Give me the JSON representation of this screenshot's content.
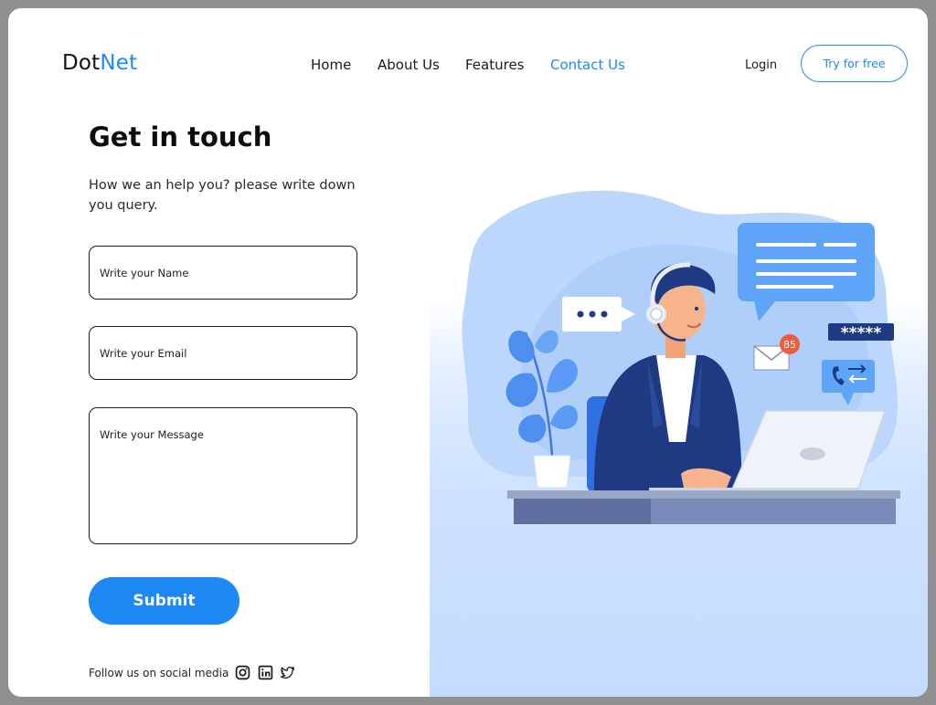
{
  "header": {
    "logo_part1": "Dot",
    "logo_part2": "Net",
    "nav": [
      "Home",
      "About Us",
      "Features",
      "Contact Us"
    ],
    "active_nav": "Contact Us",
    "login_label": "Login",
    "cta_label": "Try for free"
  },
  "contact": {
    "title": "Get in touch",
    "subtitle": "How we an help you? please write down you query.",
    "name_placeholder": "Write your Name",
    "email_placeholder": "Write your Email",
    "message_placeholder": "Write your Message",
    "submit_label": "Submit"
  },
  "footer": {
    "follow_label": "Follow us on social media",
    "icons": [
      "instagram-icon",
      "linkedin-icon",
      "twitter-icon"
    ]
  },
  "illustration": {
    "notification_count": "85",
    "password_mask": "*****"
  },
  "colors": {
    "accent": "#1e88f5",
    "illustration_blue": "#5ea4f8",
    "suit_navy": "#1e3a82"
  }
}
